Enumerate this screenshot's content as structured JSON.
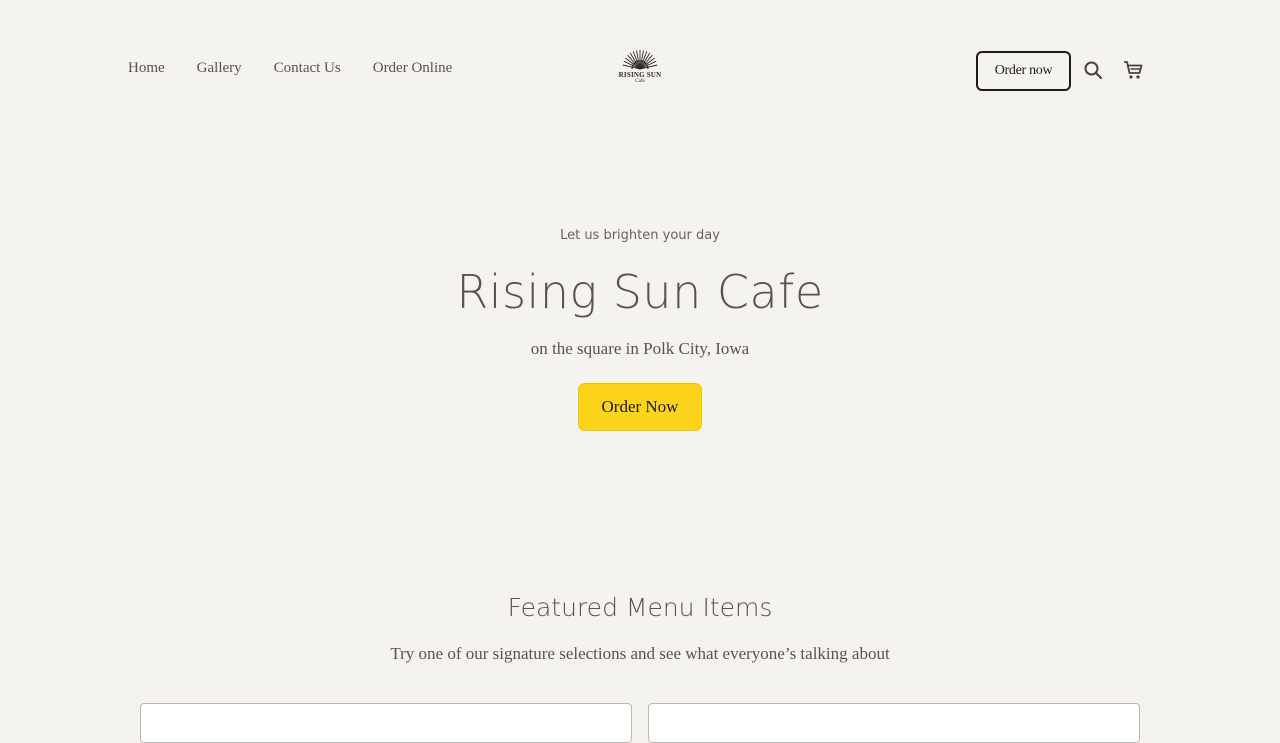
{
  "nav": {
    "items": [
      "Home",
      "Gallery",
      "Contact Us",
      "Order Online"
    ]
  },
  "logo": {
    "name": "RISING SUN",
    "sub": "Cafe",
    "icon": "sunburst-logo-icon"
  },
  "header": {
    "order_label": "Order now",
    "search_icon": "search-icon",
    "cart_icon": "cart-icon"
  },
  "hero": {
    "tagline": "Let us brighten your day",
    "title": "Rising Sun Cafe",
    "subtitle": "on the square in Polk City, Iowa",
    "button_label": "Order Now"
  },
  "featured": {
    "title": "Featured Menu Items",
    "subtitle": "Try one of our signature selections and see what everyone’s talking about"
  },
  "colors": {
    "background": "#f5f3ef",
    "text": "#5c524d",
    "accent": "#fcd41c"
  }
}
